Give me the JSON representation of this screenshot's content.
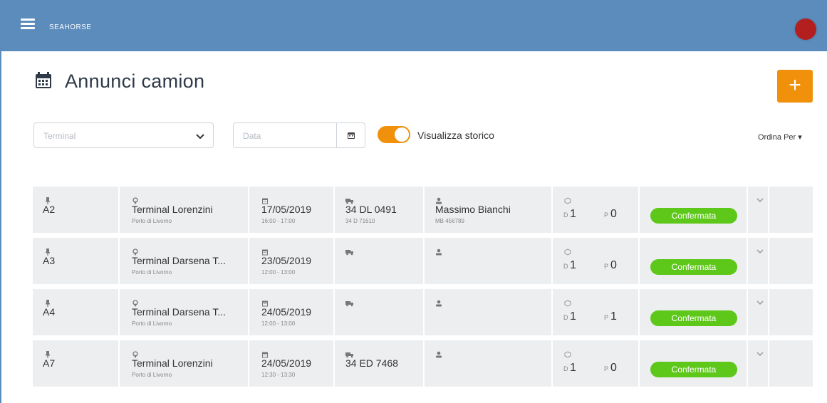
{
  "header": {
    "app_name": "SEAHORSE"
  },
  "page": {
    "title": "Annunci camion",
    "add_label": "+"
  },
  "filters": {
    "terminal_placeholder": "Terminal",
    "date_placeholder": "Data",
    "history_label": "Visualizza storico",
    "history_on": true,
    "order_label": "Ordina Per"
  },
  "rows": [
    {
      "code": "A2",
      "terminal": "Terminal Lorenzini",
      "port": "Porto di Livorno",
      "date": "17/05/2019",
      "time": "16:00 - 17:00",
      "plate": "34 DL 0491",
      "plate_sub": "34 D 71610",
      "driver": "Massimo Bianchi",
      "driver_sub": "MB 456789",
      "d_label": "D",
      "d_value": "1",
      "p_label": "P",
      "p_value": "0",
      "status": "Confermata"
    },
    {
      "code": "A3",
      "terminal": "Terminal Darsena T...",
      "port": "Porto di Livorno",
      "date": "23/05/2019",
      "time": "12:00 - 13:00",
      "plate": "",
      "plate_sub": "",
      "driver": "",
      "driver_sub": "",
      "d_label": "D",
      "d_value": "1",
      "p_label": "P",
      "p_value": "0",
      "status": "Confermata"
    },
    {
      "code": "A4",
      "terminal": "Terminal Darsena T...",
      "port": "Porto di Livorno",
      "date": "24/05/2019",
      "time": "12:00 - 13:00",
      "plate": "",
      "plate_sub": "",
      "driver": "",
      "driver_sub": "",
      "d_label": "D",
      "d_value": "1",
      "p_label": "P",
      "p_value": "1",
      "status": "Confermata"
    },
    {
      "code": "A7",
      "terminal": "Terminal Lorenzini",
      "port": "Porto di Livorno",
      "date": "24/05/2019",
      "time": "12:30 - 13:30",
      "plate": "34 ED 7468",
      "plate_sub": "",
      "driver": "",
      "driver_sub": "",
      "d_label": "D",
      "d_value": "1",
      "p_label": "P",
      "p_value": "0",
      "status": "Confermata"
    }
  ],
  "colors": {
    "appbar": "#5b8cbc",
    "accent": "#f0900b",
    "status": "#5ec81a",
    "avatar": "#b31f1f"
  }
}
